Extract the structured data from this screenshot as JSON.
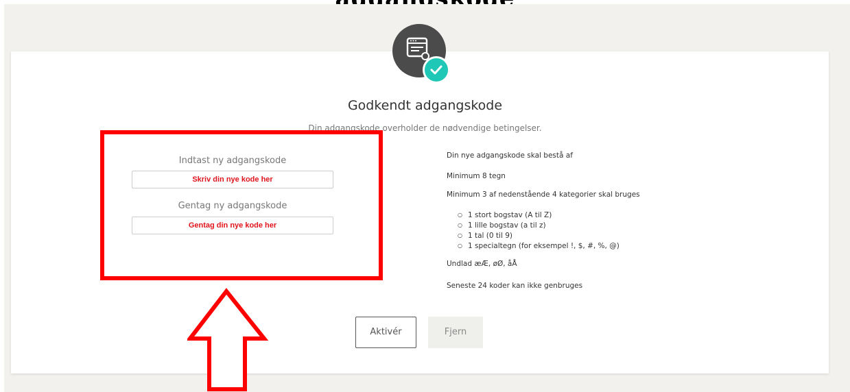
{
  "top_title": "adgangskode",
  "status": {
    "heading": "Godkendt adgangskode",
    "subtitle": "Din adgangskode overholder de nødvendige betingelser."
  },
  "form": {
    "new_password_label": "Indtast ny adgangskode",
    "new_password_value": "Skriv din nye kode her",
    "repeat_password_label": "Gentag ny adgangskode",
    "repeat_password_value": "Gentag din nye kode her"
  },
  "requirements": {
    "title": "Din nye adgangskode skal bestå af",
    "min_length": "Minimum 8 tegn",
    "min_categories": "Minimum 3 af nedenstående 4 kategorier skal bruges",
    "categories": [
      "1 stort bogstav (A til Z)",
      "1 lille bogstav (a til z)",
      "1 tal (0 til 9)",
      "1 specialtegn (for eksempel !, $, #, %, @)"
    ],
    "avoid": "Undlad æÆ, øØ, åÅ",
    "history": "Seneste 24 koder kan ikke genbruges"
  },
  "buttons": {
    "activate": "Aktivér",
    "remove": "Fjern"
  },
  "colors": {
    "highlight": "#ff0000",
    "check_badge": "#1fc7b7",
    "value_text": "#e0141c"
  },
  "icons": {
    "badge": "password-window-icon",
    "check": "checkmark-icon",
    "annotation": "up-arrow-icon"
  }
}
